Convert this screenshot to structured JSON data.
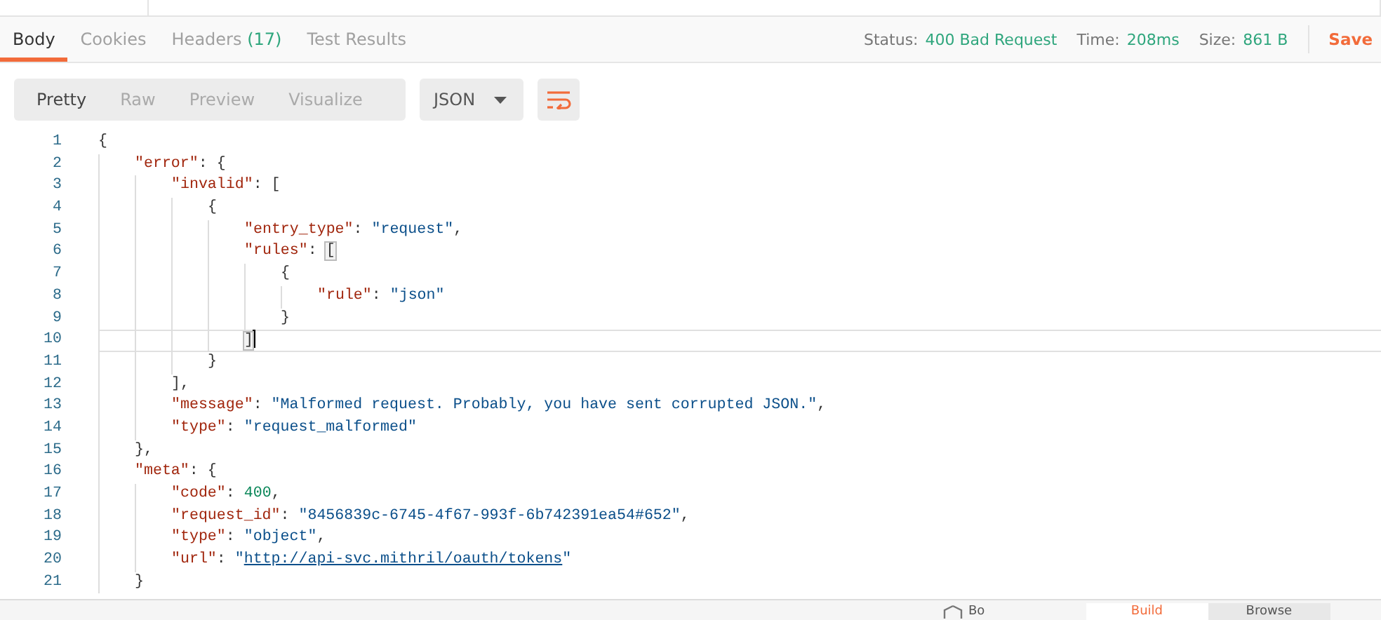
{
  "response_tabs": [
    {
      "label": "Body",
      "selected": true
    },
    {
      "label": "Cookies",
      "selected": false
    },
    {
      "label": "Headers",
      "count": "(17)",
      "selected": false
    },
    {
      "label": "Test Results",
      "selected": false
    }
  ],
  "status": [
    {
      "label": "Status:",
      "value": "400 Bad Request"
    },
    {
      "label": "Time:",
      "value": "208ms"
    },
    {
      "label": "Size:",
      "value": "861 B"
    }
  ],
  "save_button": "Save",
  "view_modes": [
    {
      "label": "Pretty",
      "selected": true
    },
    {
      "label": "Raw",
      "selected": false
    },
    {
      "label": "Preview",
      "selected": false
    },
    {
      "label": "Visualize",
      "selected": false
    }
  ],
  "format_dropdown": "JSON",
  "wrap_button": {
    "on": true
  },
  "code_lines": [
    {
      "number": "1",
      "current": false,
      "tokens": [
        {
          "kind": "punct",
          "text": "{"
        }
      ]
    },
    {
      "number": "2",
      "current": false,
      "tokens": [
        {
          "kind": "key",
          "text": "\"error\""
        },
        {
          "kind": "punct",
          "text": ": {"
        }
      ]
    },
    {
      "number": "3",
      "current": false,
      "tokens": [
        {
          "kind": "key",
          "text": "\"invalid\""
        },
        {
          "kind": "punct",
          "text": ": ["
        }
      ]
    },
    {
      "number": "4",
      "current": false,
      "tokens": [
        {
          "kind": "punct",
          "text": "{"
        }
      ]
    },
    {
      "number": "5",
      "current": false,
      "tokens": [
        {
          "kind": "key",
          "text": "\"entry_type\""
        },
        {
          "kind": "punct",
          "text": ": "
        },
        {
          "kind": "string",
          "text": "\"request\""
        },
        {
          "kind": "punct",
          "text": ","
        }
      ]
    },
    {
      "number": "6",
      "current": false,
      "tokens": [
        {
          "kind": "key",
          "text": "\"rules\""
        },
        {
          "kind": "punct",
          "text": ": "
        },
        {
          "kind": "match",
          "text": "["
        }
      ]
    },
    {
      "number": "7",
      "current": false,
      "tokens": [
        {
          "kind": "punct",
          "text": "{"
        }
      ]
    },
    {
      "number": "8",
      "current": false,
      "tokens": [
        {
          "kind": "key",
          "text": "\"rule\""
        },
        {
          "kind": "punct",
          "text": ": "
        },
        {
          "kind": "string",
          "text": "\"json\""
        }
      ]
    },
    {
      "number": "9",
      "current": false,
      "tokens": [
        {
          "kind": "punct",
          "text": "}"
        }
      ]
    },
    {
      "number": "10",
      "current": true,
      "tokens": [
        {
          "kind": "match",
          "text": "]"
        }
      ]
    },
    {
      "number": "11",
      "current": false,
      "tokens": [
        {
          "kind": "punct",
          "text": "}"
        }
      ]
    },
    {
      "number": "12",
      "current": false,
      "tokens": [
        {
          "kind": "punct",
          "text": "],"
        }
      ]
    },
    {
      "number": "13",
      "current": false,
      "tokens": [
        {
          "kind": "key",
          "text": "\"message\""
        },
        {
          "kind": "punct",
          "text": ": "
        },
        {
          "kind": "string",
          "text": "\"Malformed request. Probably, you have sent corrupted JSON.\""
        },
        {
          "kind": "punct",
          "text": ","
        }
      ]
    },
    {
      "number": "14",
      "current": false,
      "tokens": [
        {
          "kind": "key",
          "text": "\"type\""
        },
        {
          "kind": "punct",
          "text": ": "
        },
        {
          "kind": "string",
          "text": "\"request_malformed\""
        }
      ]
    },
    {
      "number": "15",
      "current": false,
      "tokens": [
        {
          "kind": "punct",
          "text": "},"
        }
      ]
    },
    {
      "number": "16",
      "current": false,
      "tokens": [
        {
          "kind": "key",
          "text": "\"meta\""
        },
        {
          "kind": "punct",
          "text": ": {"
        }
      ]
    },
    {
      "number": "17",
      "current": false,
      "tokens": [
        {
          "kind": "key",
          "text": "\"code\""
        },
        {
          "kind": "punct",
          "text": ": "
        },
        {
          "kind": "number",
          "text": "400"
        },
        {
          "kind": "punct",
          "text": ","
        }
      ]
    },
    {
      "number": "18",
      "current": false,
      "tokens": [
        {
          "kind": "key",
          "text": "\"request_id\""
        },
        {
          "kind": "punct",
          "text": ": "
        },
        {
          "kind": "string",
          "text": "\"8456839c-6745-4f67-993f-6b742391ea54#652\""
        },
        {
          "kind": "punct",
          "text": ","
        }
      ]
    },
    {
      "number": "19",
      "current": false,
      "tokens": [
        {
          "kind": "key",
          "text": "\"type\""
        },
        {
          "kind": "punct",
          "text": ": "
        },
        {
          "kind": "string",
          "text": "\"object\""
        },
        {
          "kind": "punct",
          "text": ","
        }
      ]
    },
    {
      "number": "20",
      "current": false,
      "tokens": [
        {
          "kind": "key",
          "text": "\"url\""
        },
        {
          "kind": "punct",
          "text": ": "
        },
        {
          "kind": "string",
          "text": "\""
        },
        {
          "kind": "link",
          "text": "http://api-svc.mithril/oauth/tokens"
        },
        {
          "kind": "string",
          "text": "\""
        }
      ]
    },
    {
      "number": "21",
      "current": false,
      "tokens": [
        {
          "kind": "punct",
          "text": "}"
        }
      ]
    }
  ],
  "bottom_bar": {
    "item": "Bo",
    "tabs": [
      {
        "label": "Build",
        "selected": true
      },
      {
        "label": "Browse",
        "selected": false
      }
    ]
  }
}
